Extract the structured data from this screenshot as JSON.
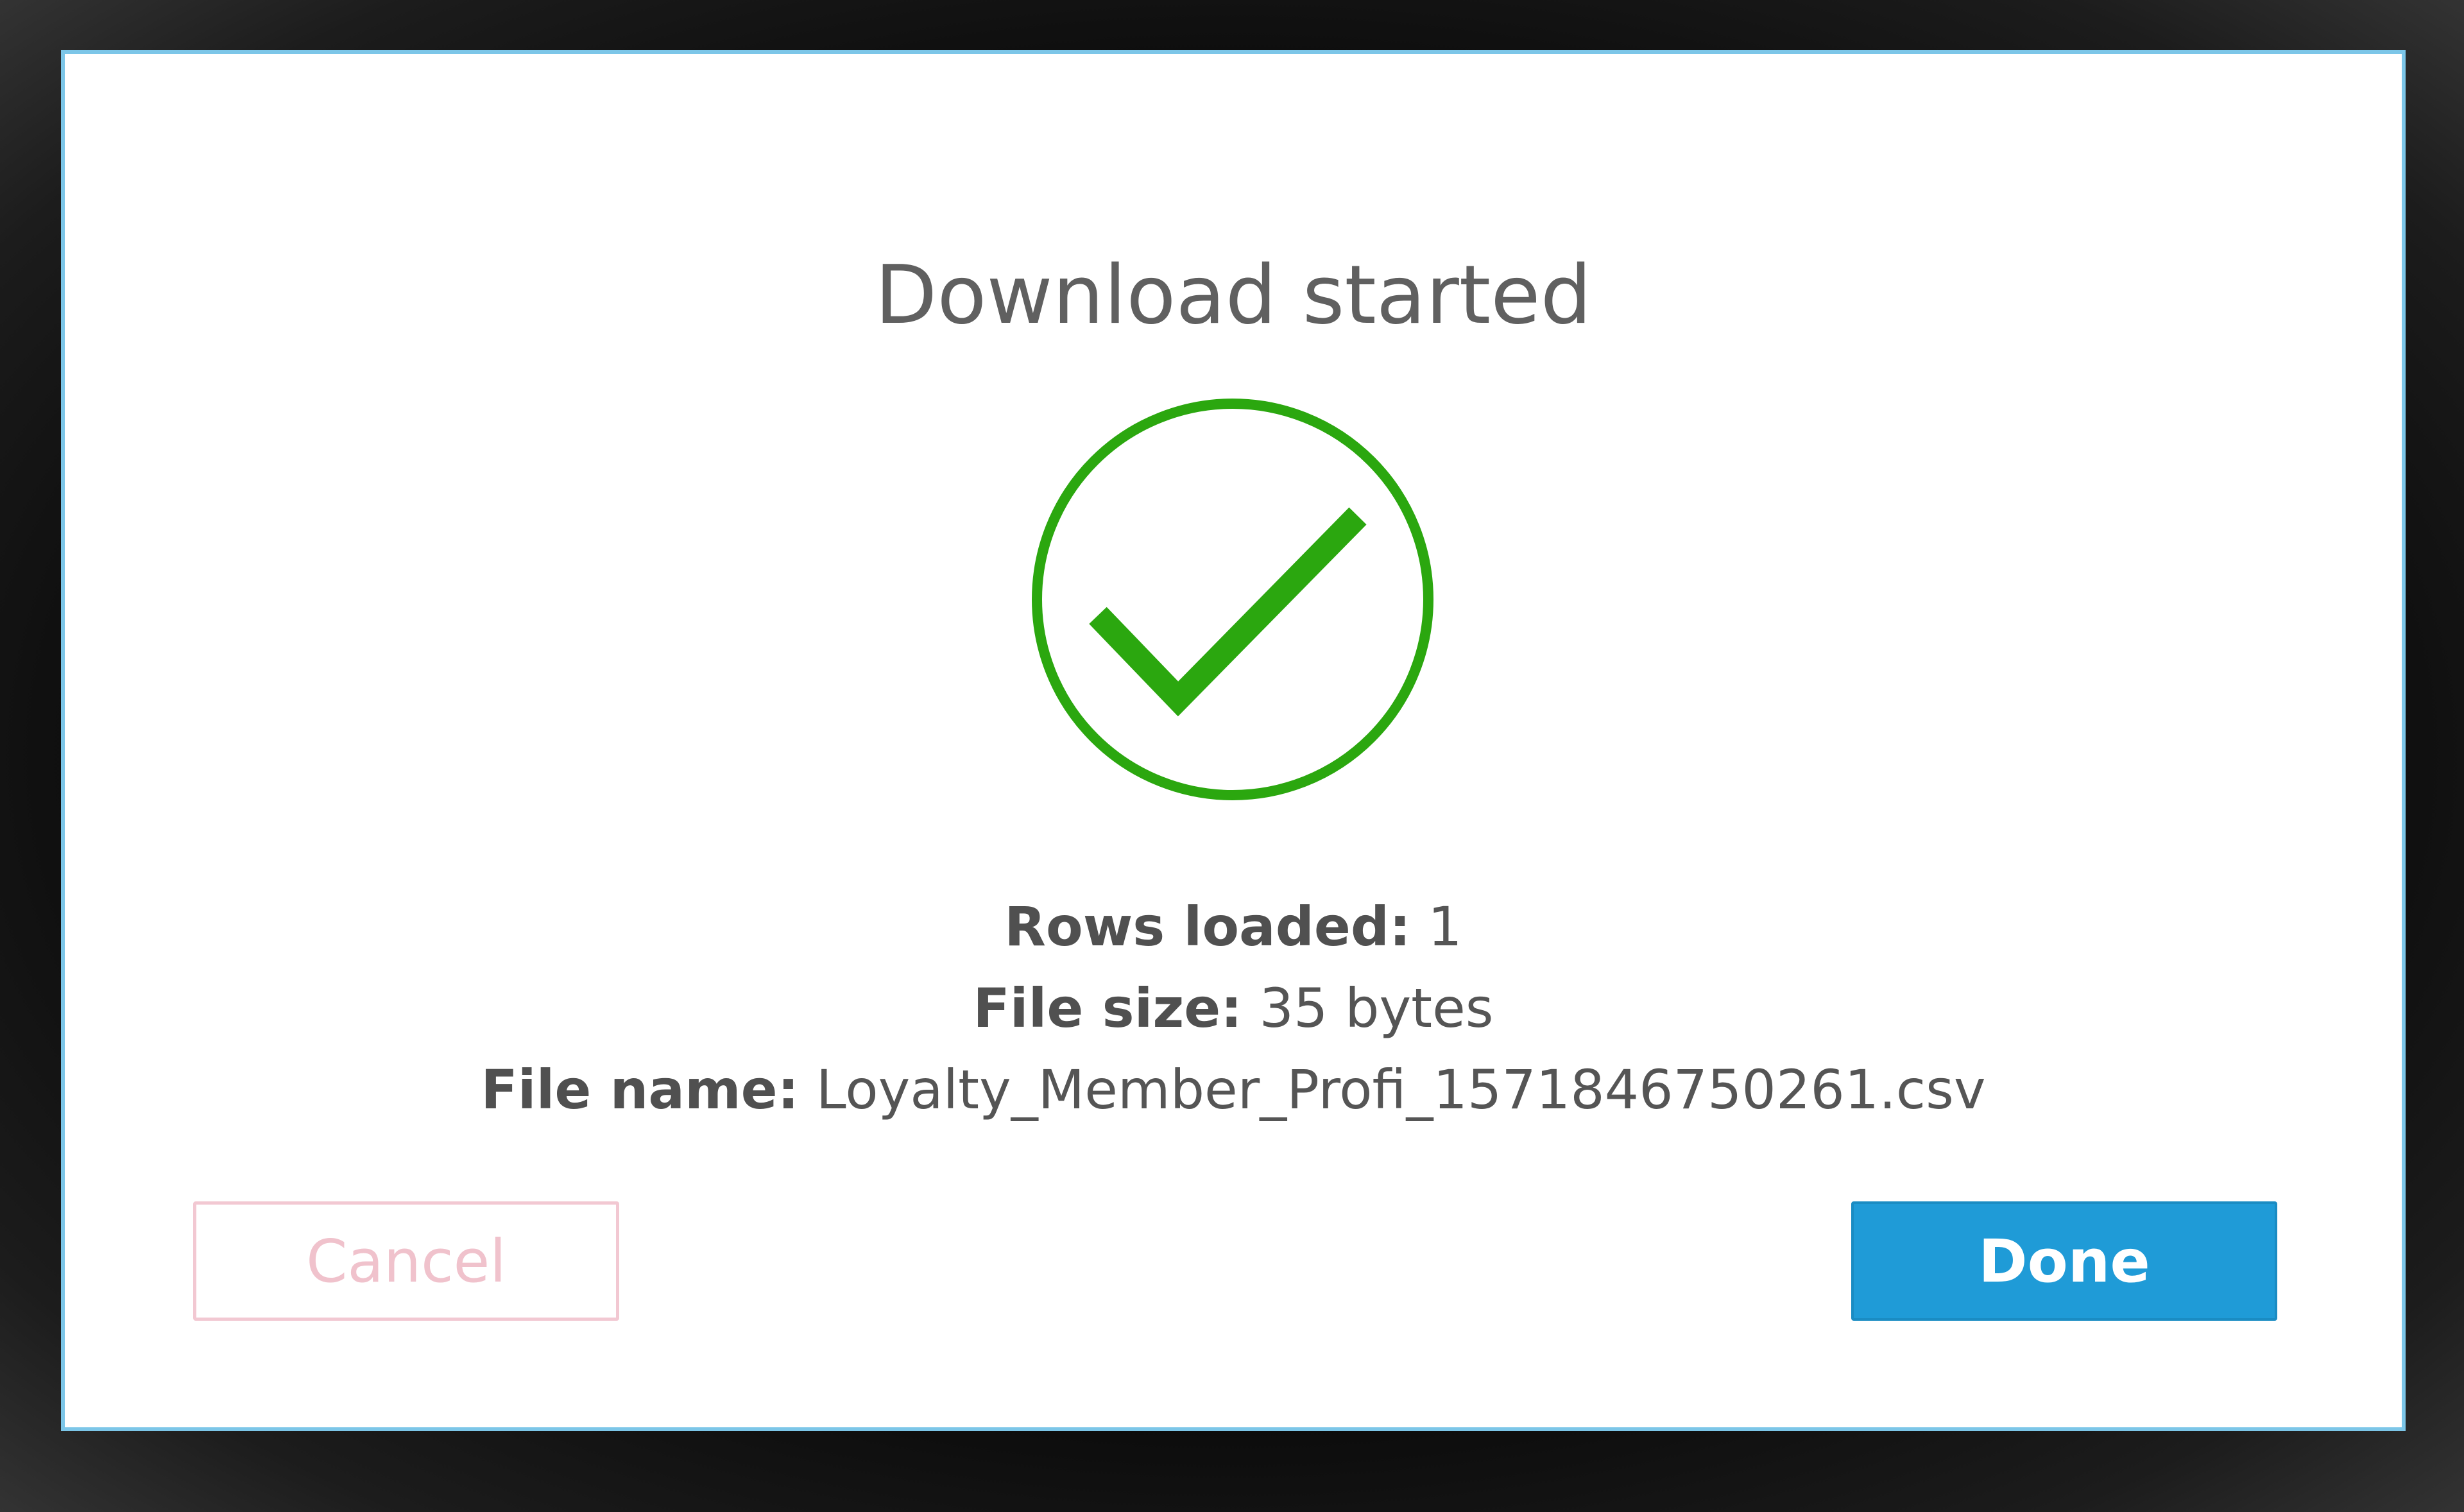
{
  "dialog": {
    "title": "Download started",
    "status_icon": "check-circle-icon",
    "colors": {
      "success": "#2ba70f",
      "primary": "#1f9bd7",
      "cancel_border": "#f2c8d2"
    },
    "details": {
      "rows_label": "Rows loaded:",
      "rows_value": "1",
      "size_label": "File size:",
      "size_value": "35 bytes",
      "name_label": "File name:",
      "name_value": "Loyalty_Member_Profi_1571846750261.csv"
    },
    "buttons": {
      "cancel_label": "Cancel",
      "done_label": "Done"
    }
  }
}
